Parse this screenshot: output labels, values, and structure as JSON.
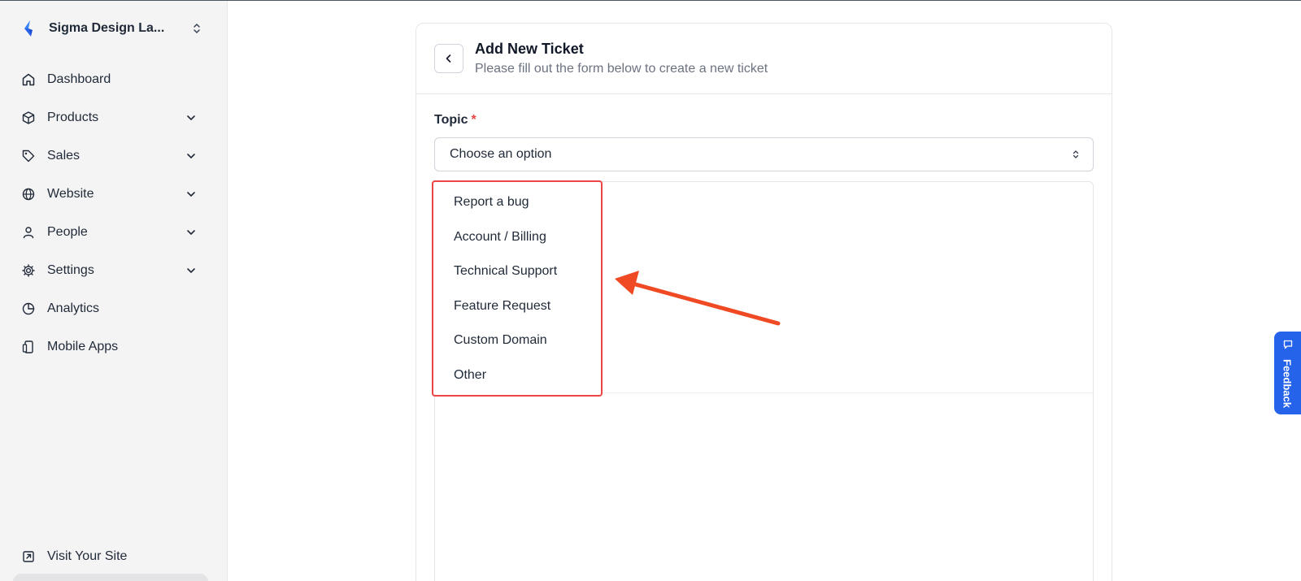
{
  "sidebar": {
    "brand": {
      "name": "Sigma Design La...",
      "icon": "brand-logo"
    },
    "items": [
      {
        "label": "Dashboard",
        "icon": "home-icon",
        "expandable": false
      },
      {
        "label": "Products",
        "icon": "box-icon",
        "expandable": true
      },
      {
        "label": "Sales",
        "icon": "tag-icon",
        "expandable": true
      },
      {
        "label": "Website",
        "icon": "globe-icon",
        "expandable": true
      },
      {
        "label": "People",
        "icon": "user-icon",
        "expandable": true
      },
      {
        "label": "Settings",
        "icon": "gear-icon",
        "expandable": true
      },
      {
        "label": "Analytics",
        "icon": "pie-chart-icon",
        "expandable": false
      },
      {
        "label": "Mobile Apps",
        "icon": "mobile-icon",
        "expandable": false
      }
    ],
    "footer": {
      "visit_label": "Visit Your Site",
      "icon": "external-link-icon"
    }
  },
  "form": {
    "title": "Add New Ticket",
    "subtitle": "Please fill out the form below to create a new ticket",
    "topic_label": "Topic",
    "required_mark": "*",
    "select_value": "Choose an option",
    "options": [
      "Report a bug",
      "Account / Billing",
      "Technical Support",
      "Feature Request",
      "Custom Domain",
      "Other"
    ]
  },
  "feedback": {
    "label": "Feedback",
    "icon": "chat-icon"
  },
  "colors": {
    "accent": "#2563eb",
    "highlight": "#ef4444",
    "arrow": "#f04a25",
    "sidebar_bg": "#f4f4f5"
  }
}
